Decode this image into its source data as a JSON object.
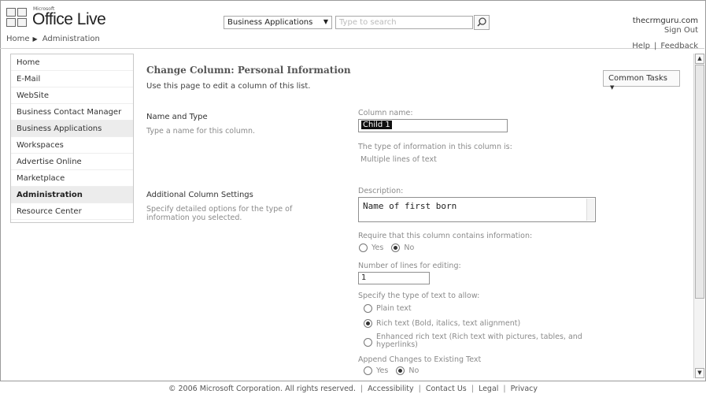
{
  "header": {
    "logo_small": "Microsoft",
    "logo_text": "Office Live",
    "breadcrumb": [
      "Home",
      "Administration"
    ],
    "search_scope": "Business Applications",
    "search_placeholder": "Type to search",
    "user_name": "thecrmguru.com",
    "sign_out": "Sign Out",
    "help": "Help",
    "feedback": "Feedback"
  },
  "sidebar": {
    "items": [
      {
        "label": "Home"
      },
      {
        "label": "E-Mail"
      },
      {
        "label": "WebSite"
      },
      {
        "label": "Business Contact Manager"
      },
      {
        "label": "Business Applications"
      },
      {
        "label": "Workspaces"
      },
      {
        "label": "Advertise Online"
      },
      {
        "label": "Marketplace"
      },
      {
        "label": "Administration"
      },
      {
        "label": "Resource Center"
      }
    ],
    "active": "Administration"
  },
  "main": {
    "title": "Change Column: Personal Information",
    "subtitle": "Use this page to edit a column of this list.",
    "common_tasks": "Common Tasks",
    "name_type": {
      "title": "Name and Type",
      "desc": "Type a name for this column.",
      "column_name_label": "Column name:",
      "column_name_value": "Child 1",
      "type_info_label": "The type of information in this column is:",
      "type_info_value": "Multiple lines of text"
    },
    "additional": {
      "title": "Additional Column Settings",
      "desc_line1": "Specify detailed options for the type of",
      "desc_line2": "information you selected.",
      "description_label": "Description:",
      "description_value": "Name of first born",
      "require_label": "Require that this column contains information:",
      "yes": "Yes",
      "no": "No",
      "require_selected": "No",
      "lines_label": "Number of lines for editing:",
      "lines_value": "1",
      "text_type_label": "Specify the type of text to allow:",
      "plain_text": "Plain text",
      "rich_text": "Rich text (Bold, italics, text alignment)",
      "enhanced_line1": "Enhanced rich text (Rich text with pictures, tables, and",
      "enhanced_line2": "hyperlinks)",
      "text_type_selected": "Rich text",
      "append_label": "Append Changes to Existing Text",
      "append_selected": "No"
    }
  },
  "footer": {
    "copyright": "© 2006 Microsoft Corporation. All rights reserved.",
    "links": [
      "Accessibility",
      "Contact Us",
      "Legal",
      "Privacy"
    ]
  },
  "colors": {
    "border": "#9a9a9a",
    "active_bg": "#ececec",
    "muted_text": "#8a8a8a"
  }
}
